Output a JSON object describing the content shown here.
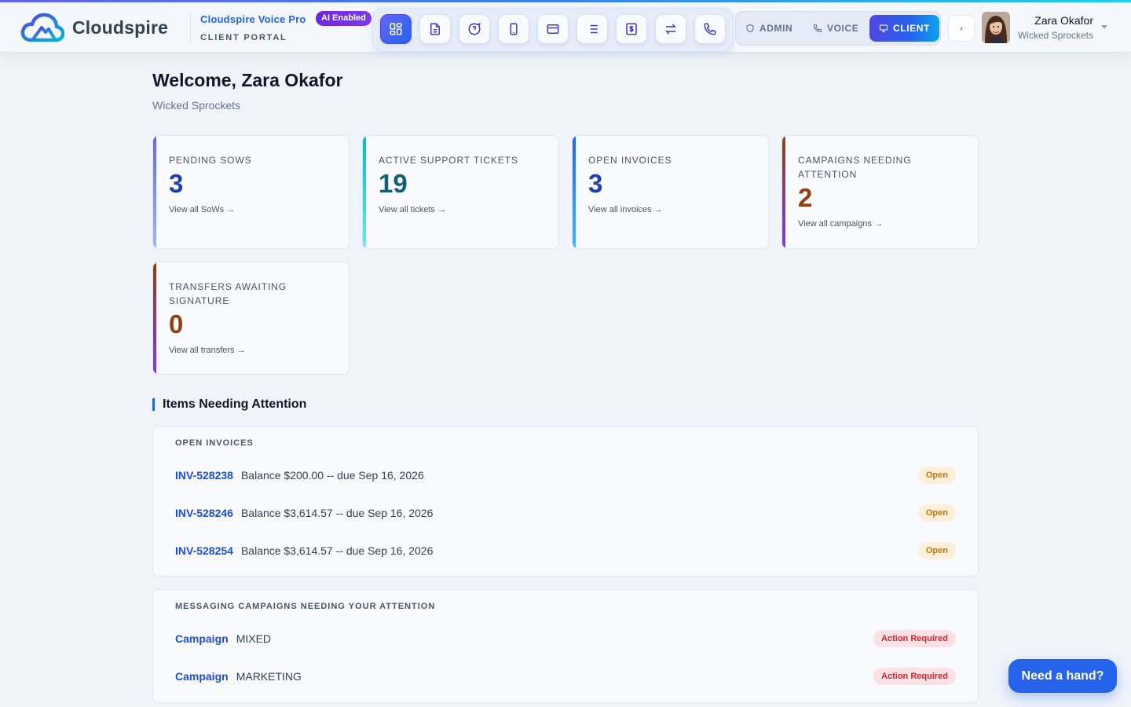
{
  "header": {
    "brand": "Cloudspire",
    "product_name": "Cloudspire Voice Pro",
    "ai_badge": "AI Enabled",
    "portal_label": "CLIENT PORTAL",
    "nav_icons": [
      "dashboard-icon",
      "document-icon",
      "support-chat-icon",
      "device-icon",
      "billing-card-icon",
      "list-icon",
      "invoice-icon",
      "transfer-icon",
      "phone-icon"
    ],
    "modes": [
      {
        "label": "ADMIN",
        "icon": "shield-icon"
      },
      {
        "label": "VOICE",
        "icon": "phone-icon"
      },
      {
        "label": "CLIENT",
        "icon": "monitor-icon"
      }
    ],
    "active_mode": "CLIENT",
    "collapse_glyph": "›",
    "user": {
      "name": "Zara Okafor",
      "org": "Wicked Sprockets"
    }
  },
  "welcome": {
    "title": "Welcome, Zara Okafor",
    "subtitle": "Wicked Sprockets"
  },
  "stats": [
    {
      "label": "PENDING SOWS",
      "value": "3",
      "link": "View all SoWs →",
      "color": "#1e40af",
      "accent": "#6366f1"
    },
    {
      "label": "ACTIVE SUPPORT TICKETS",
      "value": "19",
      "link": "View all tickets →",
      "color": "#155e75",
      "accent": "#22d3ee"
    },
    {
      "label": "OPEN INVOICES",
      "value": "3",
      "link": "View all invoices →",
      "color": "#1e40af",
      "accent": "#0ea5e9"
    },
    {
      "label": "CAMPAIGNS NEEDING ATTENTION",
      "value": "2",
      "link": "View all campaigns →",
      "color": "#92400e",
      "accent": "#7c3aed"
    },
    {
      "label": "TRANSFERS AWAITING SIGNATURE",
      "value": "0",
      "link": "View all transfers →",
      "color": "#92400e",
      "accent": "#7c3aed"
    }
  ],
  "attention": {
    "title": "Items Needing Attention",
    "invoices": {
      "title": "OPEN INVOICES",
      "rows": [
        {
          "ref": "INV-528238",
          "text": "Balance $200.00 -- due Sep 16, 2026",
          "status": "Open"
        },
        {
          "ref": "INV-528246",
          "text": "Balance $3,614.57 -- due Sep 16, 2026",
          "status": "Open"
        },
        {
          "ref": "INV-528254",
          "text": "Balance $3,614.57 -- due Sep 16, 2026",
          "status": "Open"
        }
      ]
    },
    "campaigns": {
      "title": "MESSAGING CAMPAIGNS NEEDING YOUR ATTENTION",
      "rows": [
        {
          "ref": "Campaign",
          "text": "MIXED",
          "status": "Action Required"
        },
        {
          "ref": "Campaign",
          "text": "MARKETING",
          "status": "Action Required"
        }
      ]
    }
  },
  "help": {
    "label": "Need a hand?"
  }
}
